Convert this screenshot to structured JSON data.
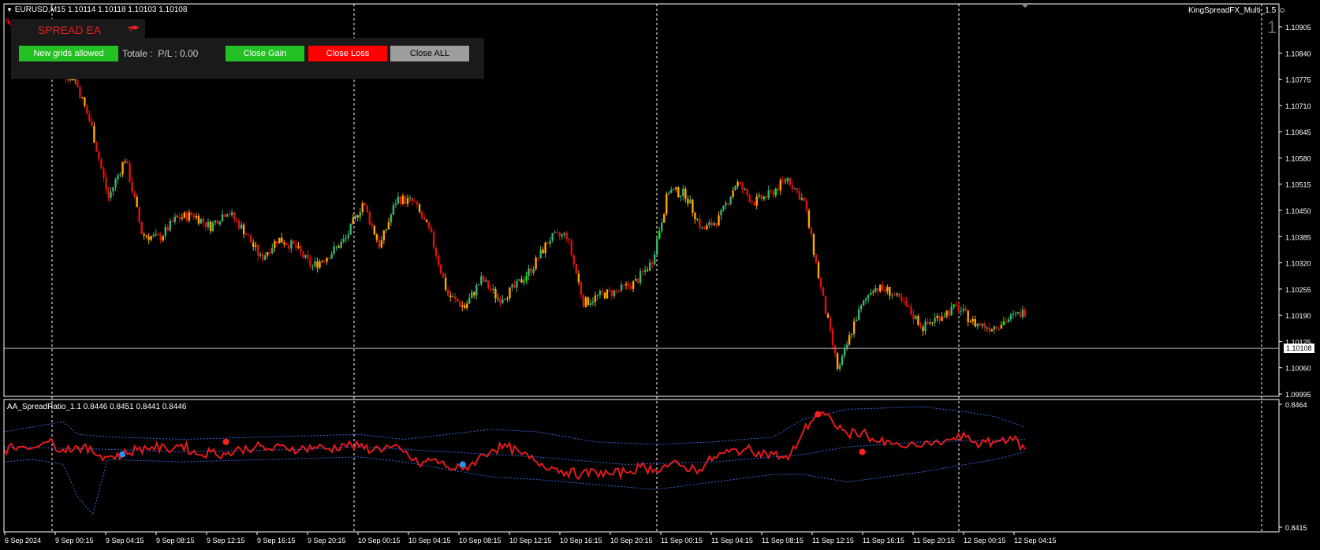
{
  "symbol_info": "EURUSD,M15  1.10114 1.10118 1.10103 1.10108",
  "indicator_name": "KingSpreadFX_Multi_1.5",
  "window_number": "1",
  "current_price_label": "1.10108",
  "subwindow_label": "AA_SpreadRatio_1.1 0.8446 0.8451 0.8441 0.8446",
  "ea_panel": {
    "title": "SPREAD EA",
    "new_grids_label": "New grids allowed",
    "totale_label": "Totale :",
    "pl_text": "P/L : 0.00",
    "close_gain_label": "Close Gain",
    "close_loss_label": "Close Loss",
    "close_all_label": "Close ALL"
  },
  "colors": {
    "bull": "#3cb371",
    "bear": "#dd1111",
    "highlight": "#ffa500",
    "bright_bull": "#00ff00",
    "ratio_line": "#e41a1c",
    "band": "#3c64dc",
    "grid": "#ffffff"
  },
  "chart_data": [
    {
      "type": "candlestick",
      "title": "EURUSD,M15",
      "y_ticks": [
        "1.10905",
        "1.10840",
        "1.10775",
        "1.10710",
        "1.10645",
        "1.10580",
        "1.10515",
        "1.10450",
        "1.10385",
        "1.10320",
        "1.10255",
        "1.10190",
        "1.10125",
        "1.10060",
        "1.09995"
      ],
      "ylim": [
        1.09995,
        1.1094
      ],
      "x_ticks": [
        "6 Sep 2024",
        "9 Sep 00:15",
        "9 Sep 04:15",
        "9 Sep 08:15",
        "9 Sep 12:15",
        "9 Sep 16:15",
        "9 Sep 20:15",
        "10 Sep 00:15",
        "10 Sep 04:15",
        "10 Sep 08:15",
        "10 Sep 12:15",
        "10 Sep 16:15",
        "10 Sep 20:15",
        "11 Sep 00:15",
        "11 Sep 04:15",
        "11 Sep 08:15",
        "11 Sep 12:15",
        "11 Sep 16:15",
        "11 Sep 20:15",
        "12 Sep 00:15",
        "12 Sep 04:15"
      ],
      "path": [
        [
          0,
          1.1092
        ],
        [
          2,
          1.1083
        ],
        [
          3,
          1.1079
        ],
        [
          4,
          1.1078
        ],
        [
          5,
          1.1066
        ],
        [
          6,
          1.1048
        ],
        [
          7,
          1.1058
        ],
        [
          8,
          1.1039
        ],
        [
          9,
          1.1038
        ],
        [
          10,
          1.1043
        ],
        [
          11,
          1.1044
        ],
        [
          12,
          1.1041
        ],
        [
          13,
          1.1045
        ],
        [
          14,
          1.104
        ],
        [
          15,
          1.1033
        ],
        [
          16,
          1.1038
        ],
        [
          17,
          1.1036
        ],
        [
          18,
          1.1031
        ],
        [
          19,
          1.1034
        ],
        [
          20,
          1.1038
        ],
        [
          21,
          1.1047
        ],
        [
          22,
          1.1036
        ],
        [
          23,
          1.1048
        ],
        [
          24,
          1.1047
        ],
        [
          25,
          1.1039
        ],
        [
          26,
          1.1024
        ],
        [
          27,
          1.1021
        ],
        [
          28,
          1.1028
        ],
        [
          29,
          1.1023
        ],
        [
          30,
          1.1026
        ],
        [
          31,
          1.1031
        ],
        [
          32,
          1.1038
        ],
        [
          33,
          1.1039
        ],
        [
          34,
          1.1022
        ],
        [
          35,
          1.1024
        ],
        [
          36,
          1.1025
        ],
        [
          37,
          1.1027
        ],
        [
          38,
          1.1032
        ],
        [
          39,
          1.105
        ],
        [
          40,
          1.1049
        ],
        [
          41,
          1.104
        ],
        [
          42,
          1.1043
        ],
        [
          43,
          1.1052
        ],
        [
          44,
          1.1047
        ],
        [
          45,
          1.1049
        ],
        [
          46,
          1.1053
        ],
        [
          47,
          1.1047
        ],
        [
          48,
          1.1025
        ],
        [
          49,
          1.1005
        ],
        [
          50,
          1.1018
        ],
        [
          51,
          1.1026
        ],
        [
          52,
          1.1025
        ],
        [
          53,
          1.1021
        ],
        [
          54,
          1.1016
        ],
        [
          55,
          1.1019
        ],
        [
          56,
          1.1021
        ],
        [
          57,
          1.1017
        ],
        [
          58,
          1.1016
        ],
        [
          60,
          1.102
        ]
      ],
      "current_price": 1.10108,
      "x_span": [
        0,
        60
      ]
    },
    {
      "type": "line",
      "title": "AA_SpreadRatio_1.1",
      "values": {
        "last": 0.8446,
        "high": 0.8451,
        "low": 0.8441,
        "close": 0.8446
      },
      "y_ticks": [
        "0.8464",
        "0.8415"
      ],
      "ylim": [
        0.8415,
        0.8464
      ],
      "ratio": [
        [
          0,
          0.8446
        ],
        [
          1,
          0.8447
        ],
        [
          3,
          0.8449
        ],
        [
          4,
          0.8446
        ],
        [
          5,
          0.8447
        ],
        [
          6,
          0.8445
        ],
        [
          7,
          0.8443
        ],
        [
          8,
          0.8444
        ],
        [
          9,
          0.8446
        ],
        [
          10,
          0.8447
        ],
        [
          11,
          0.8446
        ],
        [
          12,
          0.8448
        ],
        [
          13,
          0.8444
        ],
        [
          14,
          0.8445
        ],
        [
          15,
          0.8444
        ],
        [
          16,
          0.8446
        ],
        [
          17,
          0.8447
        ],
        [
          18,
          0.8446
        ],
        [
          19,
          0.8447
        ],
        [
          20,
          0.8446
        ],
        [
          21,
          0.8447
        ],
        [
          22,
          0.8446
        ],
        [
          23,
          0.8448
        ],
        [
          24,
          0.8447
        ],
        [
          25,
          0.8446
        ],
        [
          26,
          0.8447
        ],
        [
          27,
          0.8445
        ],
        [
          28,
          0.844
        ],
        [
          29,
          0.8442
        ],
        [
          30,
          0.8439
        ],
        [
          31,
          0.8438
        ],
        [
          32,
          0.8442
        ],
        [
          33,
          0.8446
        ],
        [
          34,
          0.8447
        ],
        [
          35,
          0.8444
        ],
        [
          36,
          0.8441
        ],
        [
          37,
          0.8439
        ],
        [
          38,
          0.8437
        ],
        [
          39,
          0.8436
        ],
        [
          40,
          0.8437
        ],
        [
          41,
          0.8436
        ],
        [
          42,
          0.8437
        ],
        [
          43,
          0.8439
        ],
        [
          44,
          0.8438
        ],
        [
          45,
          0.844
        ],
        [
          46,
          0.8439
        ],
        [
          47,
          0.8438
        ],
        [
          48,
          0.8443
        ],
        [
          49,
          0.8445
        ],
        [
          50,
          0.8446
        ],
        [
          51,
          0.8445
        ],
        [
          52,
          0.8444
        ],
        [
          53,
          0.8442
        ],
        [
          54,
          0.8453
        ],
        [
          55,
          0.8461
        ],
        [
          56,
          0.8457
        ],
        [
          57,
          0.8452
        ],
        [
          58,
          0.8453
        ],
        [
          59,
          0.8449
        ],
        [
          60,
          0.8448
        ],
        [
          62,
          0.8447
        ],
        [
          64,
          0.845
        ],
        [
          65,
          0.8451
        ],
        [
          66,
          0.8448
        ],
        [
          67,
          0.8449
        ],
        [
          68,
          0.8451
        ],
        [
          69,
          0.8446
        ]
      ],
      "band_upper": [
        [
          0,
          0.8453
        ],
        [
          2,
          0.8455
        ],
        [
          4,
          0.8457
        ],
        [
          5,
          0.8452
        ],
        [
          7,
          0.8451
        ],
        [
          12,
          0.845
        ],
        [
          18,
          0.8451
        ],
        [
          24,
          0.8452
        ],
        [
          27,
          0.845
        ],
        [
          30,
          0.8452
        ],
        [
          33,
          0.8454
        ],
        [
          36,
          0.8453
        ],
        [
          40,
          0.8449
        ],
        [
          44,
          0.8448
        ],
        [
          48,
          0.8449
        ],
        [
          52,
          0.8451
        ],
        [
          54,
          0.8458
        ],
        [
          57,
          0.8462
        ],
        [
          62,
          0.8463
        ],
        [
          65,
          0.8461
        ],
        [
          67,
          0.8459
        ],
        [
          69,
          0.8455
        ]
      ],
      "band_lower": [
        [
          0,
          0.8441
        ],
        [
          2,
          0.8442
        ],
        [
          4,
          0.844
        ],
        [
          5,
          0.8427
        ],
        [
          6,
          0.842
        ],
        [
          7,
          0.8442
        ],
        [
          12,
          0.8441
        ],
        [
          18,
          0.8442
        ],
        [
          24,
          0.8443
        ],
        [
          27,
          0.8441
        ],
        [
          30,
          0.8438
        ],
        [
          33,
          0.8435
        ],
        [
          36,
          0.8434
        ],
        [
          40,
          0.8432
        ],
        [
          44,
          0.843
        ],
        [
          48,
          0.8433
        ],
        [
          52,
          0.8436
        ],
        [
          54,
          0.8436
        ],
        [
          57,
          0.8433
        ],
        [
          62,
          0.8437
        ],
        [
          65,
          0.844
        ],
        [
          67,
          0.8442
        ],
        [
          69,
          0.8445
        ]
      ],
      "middle": [
        [
          0,
          0.8447
        ],
        [
          7,
          0.8446
        ],
        [
          12,
          0.8445
        ],
        [
          20,
          0.8446
        ],
        [
          24,
          0.8447
        ],
        [
          30,
          0.8445
        ],
        [
          36,
          0.8443
        ],
        [
          42,
          0.844
        ],
        [
          48,
          0.8441
        ],
        [
          54,
          0.8444
        ],
        [
          57,
          0.8447
        ],
        [
          62,
          0.8449
        ],
        [
          69,
          0.845
        ]
      ],
      "markers_red": [
        [
          15,
          0.8449
        ],
        [
          55,
          0.846
        ],
        [
          58,
          0.8445
        ]
      ],
      "markers_blue": [
        [
          8,
          0.8444
        ],
        [
          31,
          0.844
        ]
      ],
      "x_span": [
        0,
        69
      ]
    }
  ]
}
